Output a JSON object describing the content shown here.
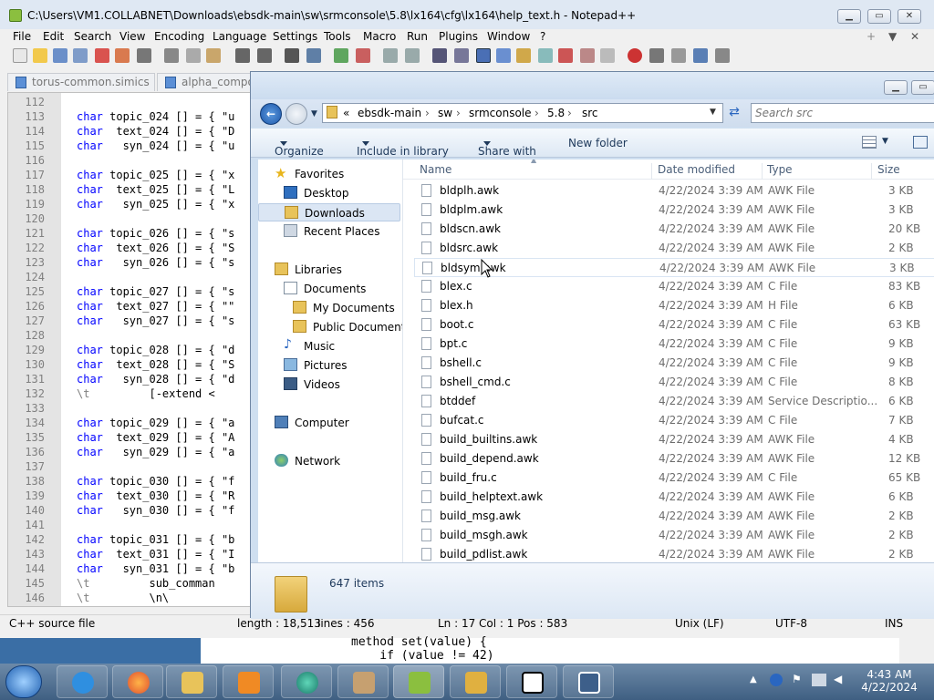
{
  "notepad": {
    "title": "C:\\Users\\VM1.COLLABNET\\Downloads\\ebsdk-main\\sw\\srmconsole\\5.8\\lx164\\cfg\\lx164\\help_text.h - Notepad++",
    "menu": [
      "File",
      "Edit",
      "Search",
      "View",
      "Encoding",
      "Language",
      "Settings",
      "Tools",
      "Macro",
      "Run",
      "Plugins",
      "Window",
      "?"
    ],
    "tabs": [
      "torus-common.simics",
      "alpha_compon"
    ],
    "lines": [
      {
        "n": "112",
        "pre": "",
        "kw": "",
        "rest": ""
      },
      {
        "n": "113",
        "pre": "",
        "kw": "char",
        "rest": " topic_024 [] = { \"u"
      },
      {
        "n": "114",
        "pre": "",
        "kw": "char",
        "rest": "  text_024 [] = { \"D"
      },
      {
        "n": "115",
        "pre": "",
        "kw": "char",
        "rest": "   syn_024 [] = { \"u"
      },
      {
        "n": "116",
        "pre": "",
        "kw": "",
        "rest": ""
      },
      {
        "n": "117",
        "pre": "",
        "kw": "char",
        "rest": " topic_025 [] = { \"x"
      },
      {
        "n": "118",
        "pre": "",
        "kw": "char",
        "rest": "  text_025 [] = { \"L"
      },
      {
        "n": "119",
        "pre": "",
        "kw": "char",
        "rest": "   syn_025 [] = { \"x"
      },
      {
        "n": "120",
        "pre": "",
        "kw": "",
        "rest": ""
      },
      {
        "n": "121",
        "pre": "",
        "kw": "char",
        "rest": " topic_026 [] = { \"s"
      },
      {
        "n": "122",
        "pre": "",
        "kw": "char",
        "rest": "  text_026 [] = { \"S"
      },
      {
        "n": "123",
        "pre": "",
        "kw": "char",
        "rest": "   syn_026 [] = { \"s"
      },
      {
        "n": "124",
        "pre": "",
        "kw": "",
        "rest": ""
      },
      {
        "n": "125",
        "pre": "",
        "kw": "char",
        "rest": " topic_027 [] = { \"s"
      },
      {
        "n": "126",
        "pre": "",
        "kw": "char",
        "rest": "  text_027 [] = { \"\""
      },
      {
        "n": "127",
        "pre": "",
        "kw": "char",
        "rest": "   syn_027 [] = { \"s"
      },
      {
        "n": "128",
        "pre": "",
        "kw": "",
        "rest": ""
      },
      {
        "n": "129",
        "pre": "",
        "kw": "char",
        "rest": " topic_028 [] = { \"d"
      },
      {
        "n": "130",
        "pre": "",
        "kw": "char",
        "rest": "  text_028 [] = { \"S"
      },
      {
        "n": "131",
        "pre": "",
        "kw": "char",
        "rest": "   syn_028 [] = { \"d"
      },
      {
        "n": "132",
        "pre": "\\t",
        "kw": "",
        "rest": "         [-extend <"
      },
      {
        "n": "133",
        "pre": "",
        "kw": "",
        "rest": ""
      },
      {
        "n": "134",
        "pre": "",
        "kw": "char",
        "rest": " topic_029 [] = { \"a"
      },
      {
        "n": "135",
        "pre": "",
        "kw": "char",
        "rest": "  text_029 [] = { \"A"
      },
      {
        "n": "136",
        "pre": "",
        "kw": "char",
        "rest": "   syn_029 [] = { \"a"
      },
      {
        "n": "137",
        "pre": "",
        "kw": "",
        "rest": ""
      },
      {
        "n": "138",
        "pre": "",
        "kw": "char",
        "rest": " topic_030 [] = { \"f"
      },
      {
        "n": "139",
        "pre": "",
        "kw": "char",
        "rest": "  text_030 [] = { \"R"
      },
      {
        "n": "140",
        "pre": "",
        "kw": "char",
        "rest": "   syn_030 [] = { \"f"
      },
      {
        "n": "141",
        "pre": "",
        "kw": "",
        "rest": ""
      },
      {
        "n": "142",
        "pre": "",
        "kw": "char",
        "rest": " topic_031 [] = { \"b"
      },
      {
        "n": "143",
        "pre": "",
        "kw": "char",
        "rest": "  text_031 [] = { \"I"
      },
      {
        "n": "144",
        "pre": "",
        "kw": "char",
        "rest": "   syn_031 [] = { \"b"
      },
      {
        "n": "145",
        "pre": "\\t",
        "kw": "",
        "rest": "         sub_comman"
      },
      {
        "n": "146",
        "pre": "\\t",
        "kw": "",
        "rest": "         \\n\\"
      }
    ],
    "status": {
      "lang": "C++ source file",
      "length": "length : 18,513",
      "lines": "lines : 456",
      "pos": "Ln : 17    Col : 1    Pos : 583",
      "eol": "Unix (LF)",
      "enc": "UTF-8",
      "mode": "INS"
    }
  },
  "console": [
    "method set(value) {",
    "    if (value != 42)"
  ],
  "explorer": {
    "breadcrumb": [
      "«",
      "ebsdk-main",
      "sw",
      "srmconsole",
      "5.8",
      "src"
    ],
    "search_placeholder": "Search src",
    "commands": [
      "Organize",
      "Include in library",
      "Share with",
      "New folder"
    ],
    "nav": {
      "favorites": "Favorites",
      "desktop": "Desktop",
      "downloads": "Downloads",
      "recent": "Recent Places",
      "libraries": "Libraries",
      "documents": "Documents",
      "my_documents": "My Documents",
      "public_documents": "Public Documents",
      "music": "Music",
      "pictures": "Pictures",
      "videos": "Videos",
      "computer": "Computer",
      "network": "Network"
    },
    "columns": {
      "name": "Name",
      "date": "Date modified",
      "type": "Type",
      "size": "Size"
    },
    "files": [
      {
        "name": "bldplh.awk",
        "date": "4/22/2024 3:39 AM",
        "type": "AWK File",
        "size": "3 KB"
      },
      {
        "name": "bldplm.awk",
        "date": "4/22/2024 3:39 AM",
        "type": "AWK File",
        "size": "3 KB"
      },
      {
        "name": "bldscn.awk",
        "date": "4/22/2024 3:39 AM",
        "type": "AWK File",
        "size": "20 KB"
      },
      {
        "name": "bldsrc.awk",
        "date": "4/22/2024 3:39 AM",
        "type": "AWK File",
        "size": "2 KB"
      },
      {
        "name": "bldsym.awk",
        "date": "4/22/2024 3:39 AM",
        "type": "AWK File",
        "size": "3 KB"
      },
      {
        "name": "blex.c",
        "date": "4/22/2024 3:39 AM",
        "type": "C File",
        "size": "83 KB"
      },
      {
        "name": "blex.h",
        "date": "4/22/2024 3:39 AM",
        "type": "H File",
        "size": "6 KB"
      },
      {
        "name": "boot.c",
        "date": "4/22/2024 3:39 AM",
        "type": "C File",
        "size": "63 KB"
      },
      {
        "name": "bpt.c",
        "date": "4/22/2024 3:39 AM",
        "type": "C File",
        "size": "9 KB"
      },
      {
        "name": "bshell.c",
        "date": "4/22/2024 3:39 AM",
        "type": "C File",
        "size": "9 KB"
      },
      {
        "name": "bshell_cmd.c",
        "date": "4/22/2024 3:39 AM",
        "type": "C File",
        "size": "8 KB"
      },
      {
        "name": "btddef",
        "date": "4/22/2024 3:39 AM",
        "type": "Service Descriptio...",
        "size": "6 KB"
      },
      {
        "name": "bufcat.c",
        "date": "4/22/2024 3:39 AM",
        "type": "C File",
        "size": "7 KB"
      },
      {
        "name": "build_builtins.awk",
        "date": "4/22/2024 3:39 AM",
        "type": "AWK File",
        "size": "4 KB"
      },
      {
        "name": "build_depend.awk",
        "date": "4/22/2024 3:39 AM",
        "type": "AWK File",
        "size": "12 KB"
      },
      {
        "name": "build_fru.c",
        "date": "4/22/2024 3:39 AM",
        "type": "C File",
        "size": "65 KB"
      },
      {
        "name": "build_helptext.awk",
        "date": "4/22/2024 3:39 AM",
        "type": "AWK File",
        "size": "6 KB"
      },
      {
        "name": "build_msg.awk",
        "date": "4/22/2024 3:39 AM",
        "type": "AWK File",
        "size": "2 KB"
      },
      {
        "name": "build_msgh.awk",
        "date": "4/22/2024 3:39 AM",
        "type": "AWK File",
        "size": "2 KB"
      },
      {
        "name": "build_pdlist.awk",
        "date": "4/22/2024 3:39 AM",
        "type": "AWK File",
        "size": "2 KB"
      }
    ],
    "item_count": "647 items"
  },
  "taskbar": {
    "time": "4:43 AM",
    "date": "4/22/2024"
  }
}
